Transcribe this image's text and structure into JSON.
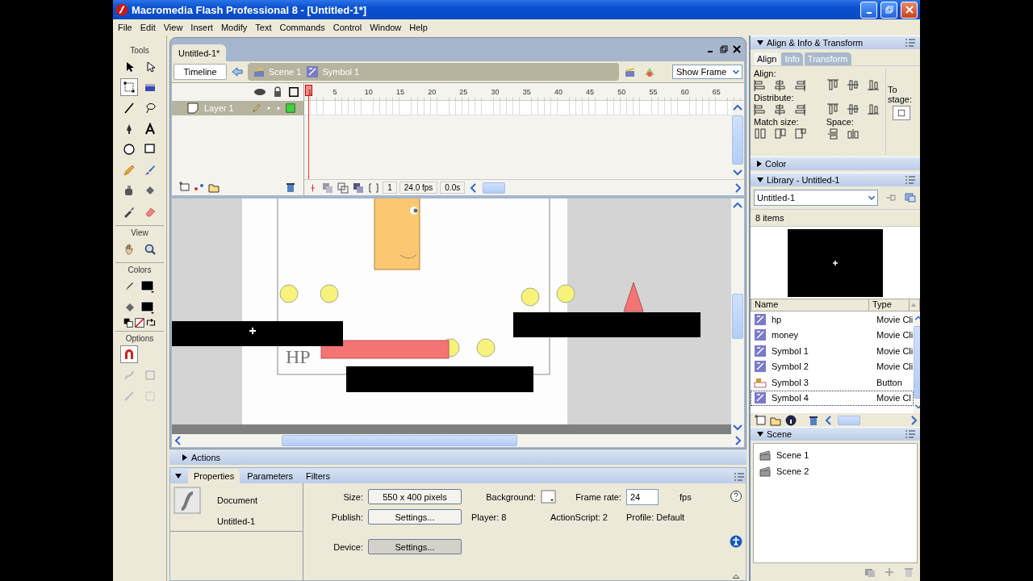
{
  "window": {
    "title": "Macromedia Flash Professional 8 - [Untitled-1*]"
  },
  "menu": [
    "File",
    "Edit",
    "View",
    "Insert",
    "Modify",
    "Text",
    "Commands",
    "Control",
    "Window",
    "Help"
  ],
  "tools": {
    "title": "Tools",
    "view_label": "View",
    "colors_label": "Colors",
    "options_label": "Options",
    "items": [
      {
        "selected": false
      },
      {
        "selected": false
      },
      {
        "selected": true
      },
      {
        "selected": false
      },
      {
        "selected": false
      },
      {
        "selected": false
      },
      {
        "selected": false
      },
      {
        "selected": false
      },
      {
        "selected": false
      },
      {
        "selected": false
      },
      {
        "selected": false
      },
      {
        "selected": false
      },
      {
        "selected": false
      },
      {
        "selected": false
      },
      {
        "selected": false
      },
      {
        "selected": false
      }
    ]
  },
  "document": {
    "tab": "Untitled-1*",
    "timeline_button": "Timeline",
    "breadcrumbs": [
      {
        "label": "Scene 1",
        "kind": "scene"
      },
      {
        "label": "Symbol 1",
        "kind": "symbol"
      }
    ],
    "zoom": "Show Frame",
    "ruler": [
      "1",
      "5",
      "10",
      "15",
      "20",
      "25",
      "30",
      "35",
      "40",
      "45",
      "50",
      "55",
      "60",
      "65"
    ],
    "layers": [
      {
        "name": "Layer 1",
        "selected": true
      }
    ],
    "current_frame": "1",
    "frame_rate": "24.0 fps",
    "elapsed": "0.0s",
    "stage_text": "HP"
  },
  "actions_panel": {
    "title": "Actions",
    "expanded": false
  },
  "properties": {
    "expanded": true,
    "tabs": [
      {
        "label": "Properties",
        "selected": true
      },
      {
        "label": "Parameters",
        "selected": false
      },
      {
        "label": "Filters",
        "selected": false
      }
    ],
    "doc_label": "Document",
    "doc_name": "Untitled-1",
    "size_label": "Size:",
    "size_value": "550 x 400 pixels",
    "background_label": "Background:",
    "frame_rate_label": "Frame rate:",
    "frame_rate": "24",
    "fps": "fps",
    "publish_label": "Publish:",
    "publish_button": "Settings...",
    "player": "Player: 8",
    "actionscript": "ActionScript: 2",
    "profile": "Profile: Default",
    "device_label": "Device:",
    "device_button": "Settings..."
  },
  "align_panel": {
    "title": "Align & Info & Transform",
    "expanded": true,
    "tabs": [
      {
        "label": "Align",
        "selected": true
      },
      {
        "label": "Info",
        "selected": false
      },
      {
        "label": "Transform",
        "selected": false
      }
    ],
    "align_label": "Align:",
    "distribute_label": "Distribute:",
    "match_label": "Match size:",
    "space_label": "Space:",
    "to_stage_label": "To stage:"
  },
  "color_panel": {
    "title": "Color",
    "expanded": false
  },
  "library": {
    "title": "Library - Untitled-1",
    "expanded": true,
    "document": "Untitled-1",
    "count": "8 items",
    "columns": [
      "Name",
      "Type"
    ],
    "items": [
      {
        "name": "hp",
        "type": "Movie Cli",
        "kind": "movieclip",
        "selected": false
      },
      {
        "name": "money",
        "type": "Movie Cli",
        "kind": "movieclip",
        "selected": false
      },
      {
        "name": "Symbol 1",
        "type": "Movie Cli",
        "kind": "movieclip",
        "selected": false
      },
      {
        "name": "Symbol 2",
        "type": "Movie Cli",
        "kind": "movieclip",
        "selected": false
      },
      {
        "name": "Symbol 3",
        "type": "Button",
        "kind": "button",
        "selected": false
      },
      {
        "name": "Symbol 4",
        "type": "Movie Cl",
        "kind": "movieclip",
        "selected": true
      }
    ]
  },
  "scene_panel": {
    "title": "Scene",
    "expanded": true,
    "scenes": [
      {
        "name": "Scene 1"
      },
      {
        "name": "Scene 2"
      }
    ]
  }
}
